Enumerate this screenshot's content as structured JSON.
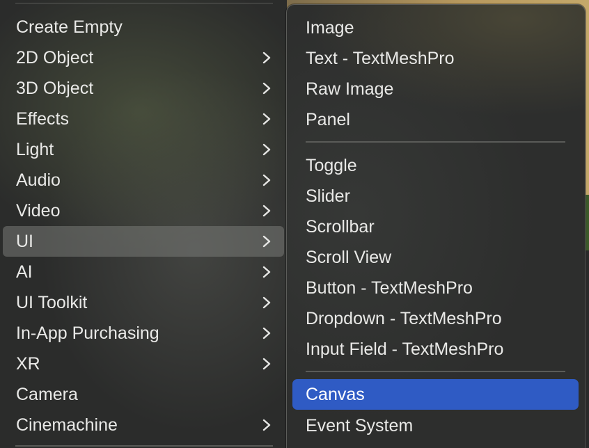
{
  "left_menu": {
    "items": [
      {
        "label": "Create Empty",
        "has_submenu": false
      },
      {
        "label": "2D Object",
        "has_submenu": true
      },
      {
        "label": "3D Object",
        "has_submenu": true
      },
      {
        "label": "Effects",
        "has_submenu": true
      },
      {
        "label": "Light",
        "has_submenu": true
      },
      {
        "label": "Audio",
        "has_submenu": true
      },
      {
        "label": "Video",
        "has_submenu": true
      },
      {
        "label": "UI",
        "has_submenu": true,
        "active": true
      },
      {
        "label": "AI",
        "has_submenu": true
      },
      {
        "label": "UI Toolkit",
        "has_submenu": true
      },
      {
        "label": "In-App Purchasing",
        "has_submenu": true
      },
      {
        "label": "XR",
        "has_submenu": true
      },
      {
        "label": "Camera",
        "has_submenu": false
      },
      {
        "label": "Cinemachine",
        "has_submenu": true
      }
    ]
  },
  "right_menu": {
    "items": [
      {
        "label": "Image"
      },
      {
        "label": "Text - TextMeshPro"
      },
      {
        "label": "Raw Image"
      },
      {
        "label": "Panel"
      },
      {
        "label": "Toggle"
      },
      {
        "label": "Slider"
      },
      {
        "label": "Scrollbar"
      },
      {
        "label": "Scroll View"
      },
      {
        "label": "Button - TextMeshPro"
      },
      {
        "label": "Dropdown - TextMeshPro"
      },
      {
        "label": "Input Field - TextMeshPro"
      },
      {
        "label": "Canvas",
        "highlighted": true
      },
      {
        "label": "Event System"
      }
    ]
  },
  "colors": {
    "highlight": "#2f5bc4",
    "active_row": "#5f605c",
    "text": "#e9e9e7"
  },
  "icons": {
    "submenu": "chevron-right-icon"
  }
}
